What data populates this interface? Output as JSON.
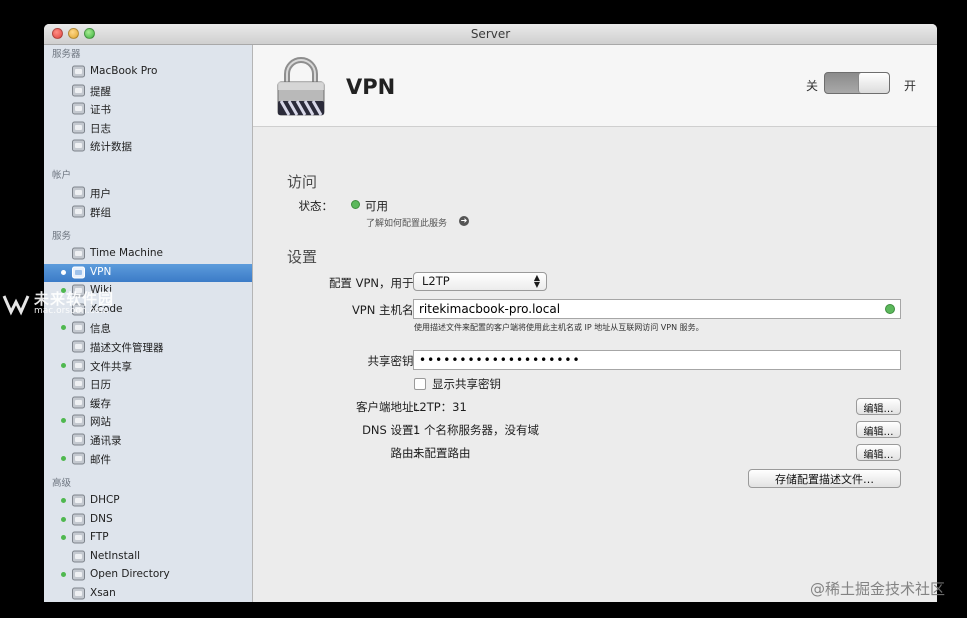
{
  "window": {
    "title": "Server"
  },
  "sidebar": {
    "sections": [
      {
        "label": "服务器",
        "items": [
          {
            "label": "MacBook Pro",
            "icon": "macbook-icon",
            "dot": false
          },
          {
            "label": "提醒",
            "icon": "megaphone-icon",
            "dot": false
          },
          {
            "label": "证书",
            "icon": "certificate-icon",
            "dot": false
          },
          {
            "label": "日志",
            "icon": "log-icon",
            "dot": false
          },
          {
            "label": "统计数据",
            "icon": "stats-icon",
            "dot": false
          }
        ]
      },
      {
        "label": "帐户",
        "items": [
          {
            "label": "用户",
            "icon": "user-icon",
            "dot": false
          },
          {
            "label": "群组",
            "icon": "group-icon",
            "dot": false
          }
        ]
      },
      {
        "label": "服务",
        "items": [
          {
            "label": "Time Machine",
            "icon": "time-machine-icon",
            "dot": false
          },
          {
            "label": "VPN",
            "icon": "vpn-lock-icon",
            "dot": true,
            "selected": true
          },
          {
            "label": "Wiki",
            "icon": "wiki-icon",
            "dot": true
          },
          {
            "label": "Xcode",
            "icon": "xcode-icon",
            "dot": false
          },
          {
            "label": "信息",
            "icon": "messages-icon",
            "dot": true
          },
          {
            "label": "描述文件管理器",
            "icon": "profile-manager-icon",
            "dot": false
          },
          {
            "label": "文件共享",
            "icon": "file-sharing-icon",
            "dot": true
          },
          {
            "label": "日历",
            "icon": "calendar-icon",
            "dot": false
          },
          {
            "label": "缓存",
            "icon": "caching-icon",
            "dot": false
          },
          {
            "label": "网站",
            "icon": "websites-icon",
            "dot": true
          },
          {
            "label": "通讯录",
            "icon": "contacts-icon",
            "dot": false
          },
          {
            "label": "邮件",
            "icon": "mail-icon",
            "dot": true
          }
        ]
      },
      {
        "label": "高级",
        "items": [
          {
            "label": "DHCP",
            "icon": "dhcp-icon",
            "dot": true
          },
          {
            "label": "DNS",
            "icon": "dns-icon",
            "dot": true
          },
          {
            "label": "FTP",
            "icon": "ftp-icon",
            "dot": true
          },
          {
            "label": "NetInstall",
            "icon": "netinstall-icon",
            "dot": false
          },
          {
            "label": "Open Directory",
            "icon": "open-directory-icon",
            "dot": true
          },
          {
            "label": "Xsan",
            "icon": "xsan-icon",
            "dot": false
          }
        ]
      }
    ]
  },
  "header": {
    "title": "VPN",
    "icon": "padlock-icon",
    "switch_off_label": "关",
    "switch_on_label": "开",
    "switch_state": "on"
  },
  "access": {
    "heading": "访问",
    "status_label": "状态：",
    "status_value": "可用",
    "status_color": "#5cb85c",
    "learn_more": "了解如何配置此服务"
  },
  "settings": {
    "heading": "设置",
    "configure_label": "配置 VPN，用于：",
    "configure_value": "L2TP",
    "hostname_label": "VPN 主机名：",
    "hostname_value": "ritekimacbook-pro.local",
    "hostname_hint": "使用描述文件来配置的客户端将使用此主机名或 IP 地址从互联网访问 VPN 服务。",
    "secret_label": "共享密钥：",
    "secret_value": "••••••••••••••••••••",
    "show_secret_label": "显示共享密钥",
    "client_label": "客户端地址：",
    "client_value": "L2TP：31",
    "dns_label": "DNS 设置：",
    "dns_value": "1 个名称服务器，没有域",
    "route_label": "路由：",
    "route_value": "未配置路由",
    "edit_label": "编辑…",
    "save_profile_label": "存储配置描述文件…"
  },
  "watermarks": {
    "left_title": "未来软件园",
    "left_url": "mac.orsoon.com",
    "right": "@稀土掘金技术社区"
  }
}
